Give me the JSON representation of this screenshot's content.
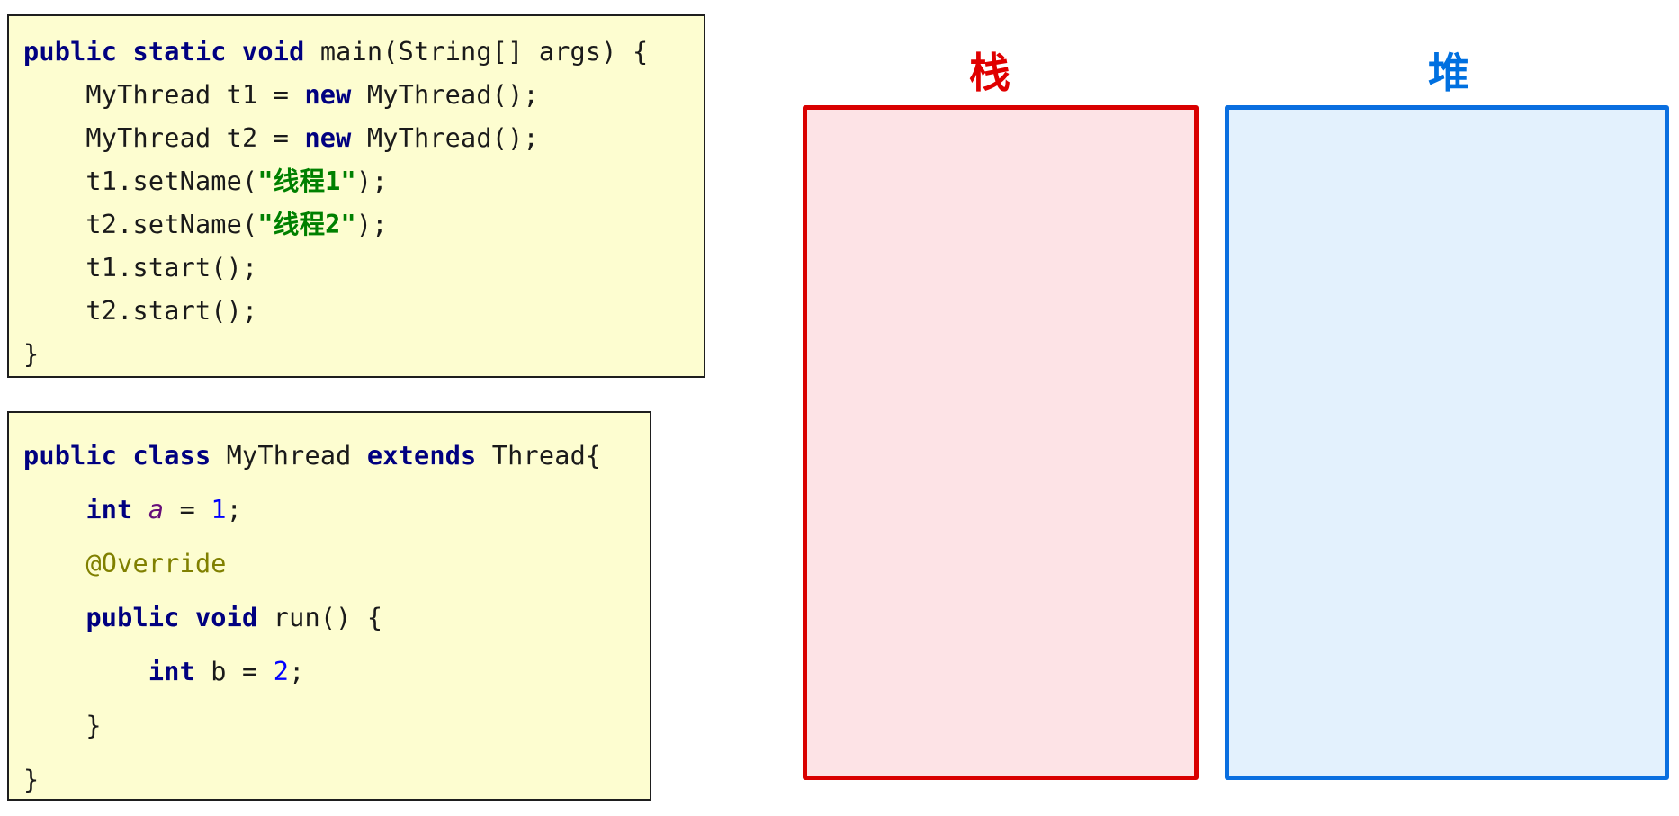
{
  "main_code": {
    "lines": [
      [
        {
          "t": "public",
          "c": "kw"
        },
        {
          "t": " ",
          "c": "txt"
        },
        {
          "t": "static",
          "c": "kw"
        },
        {
          "t": " ",
          "c": "txt"
        },
        {
          "t": "void",
          "c": "kw"
        },
        {
          "t": " main(String[] args) {",
          "c": "txt"
        }
      ],
      [
        {
          "t": "    MyThread t1 = ",
          "c": "txt"
        },
        {
          "t": "new",
          "c": "kw"
        },
        {
          "t": " MyThread();",
          "c": "txt"
        }
      ],
      [
        {
          "t": "    MyThread t2 = ",
          "c": "txt"
        },
        {
          "t": "new",
          "c": "kw"
        },
        {
          "t": " MyThread();",
          "c": "txt"
        }
      ],
      [
        {
          "t": "    t1.setName(",
          "c": "txt"
        },
        {
          "t": "\"线程1\"",
          "c": "str"
        },
        {
          "t": ");",
          "c": "txt"
        }
      ],
      [
        {
          "t": "    t2.setName(",
          "c": "txt"
        },
        {
          "t": "\"线程2\"",
          "c": "str"
        },
        {
          "t": ");",
          "c": "txt"
        }
      ],
      [
        {
          "t": "    t1.start();",
          "c": "txt"
        }
      ],
      [
        {
          "t": "    t2.start();",
          "c": "txt"
        }
      ],
      [
        {
          "t": "}",
          "c": "txt"
        }
      ]
    ]
  },
  "class_code": {
    "lines": [
      [
        {
          "t": "public",
          "c": "kw"
        },
        {
          "t": " ",
          "c": "txt"
        },
        {
          "t": "class",
          "c": "kw"
        },
        {
          "t": " MyThread ",
          "c": "txt"
        },
        {
          "t": "extends",
          "c": "kw"
        },
        {
          "t": " Thread{",
          "c": "txt"
        }
      ],
      [
        {
          "t": "    ",
          "c": "txt"
        },
        {
          "t": "int",
          "c": "kw"
        },
        {
          "t": " ",
          "c": "txt"
        },
        {
          "t": "a",
          "c": "field"
        },
        {
          "t": " = ",
          "c": "txt"
        },
        {
          "t": "1",
          "c": "num"
        },
        {
          "t": ";",
          "c": "txt"
        }
      ],
      [
        {
          "t": "    ",
          "c": "txt"
        },
        {
          "t": "@Override",
          "c": "ann"
        }
      ],
      [
        {
          "t": "    ",
          "c": "txt"
        },
        {
          "t": "public",
          "c": "kw"
        },
        {
          "t": " ",
          "c": "txt"
        },
        {
          "t": "void",
          "c": "kw"
        },
        {
          "t": " run() {",
          "c": "txt"
        }
      ],
      [
        {
          "t": "        ",
          "c": "txt"
        },
        {
          "t": "int",
          "c": "kw"
        },
        {
          "t": " b = ",
          "c": "txt"
        },
        {
          "t": "2",
          "c": "num"
        },
        {
          "t": ";",
          "c": "txt"
        }
      ],
      [
        {
          "t": "    }",
          "c": "txt"
        }
      ],
      [
        {
          "t": "}",
          "c": "txt"
        }
      ]
    ]
  },
  "regions": {
    "stack_label": "栈",
    "heap_label": "堆",
    "stack_color": "#d90000",
    "heap_color": "#0a6fe0",
    "stack_fill": "#fde3e6",
    "heap_fill": "#e3f1fd"
  }
}
